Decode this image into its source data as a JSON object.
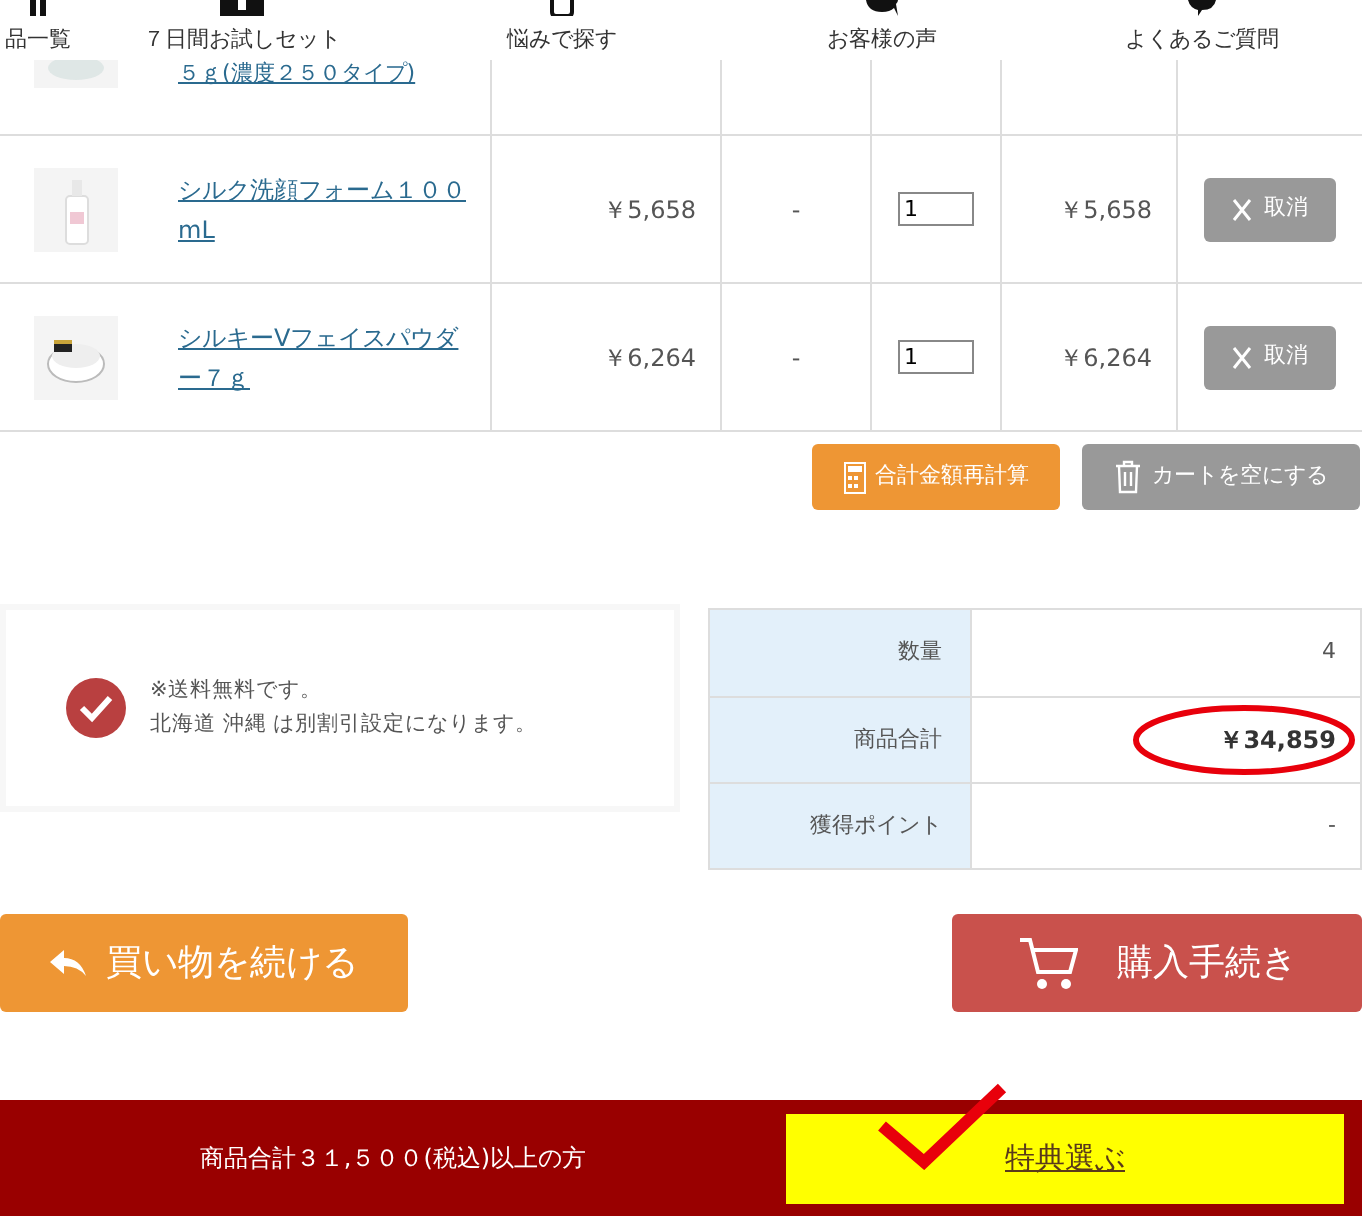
{
  "nav": [
    {
      "label": "品一覧",
      "kind": "list"
    },
    {
      "label": "７日間お試しセット",
      "kind": "box"
    },
    {
      "label": "悩みで探す",
      "kind": "phone"
    },
    {
      "label": "お客様の声",
      "kind": "chat"
    },
    {
      "label": "よくあるご質問",
      "kind": "info"
    }
  ],
  "cart": {
    "partial_row": {
      "name": "５ｇ(濃度２５０タイプ)"
    },
    "rows": [
      {
        "name": "シルク洗顔フォーム１００mL",
        "price": "￥5,658",
        "discount": "-",
        "quantity": "1",
        "subtotal": "￥5,658",
        "cancel": "取消",
        "kind": "bottle"
      },
      {
        "name": "シルキーVフェイスパウダー７ｇ",
        "price": "￥6,264",
        "discount": "-",
        "quantity": "1",
        "subtotal": "￥6,264",
        "cancel": "取消",
        "kind": "compact"
      }
    ],
    "recalc_button": "合計金額再計算",
    "empty_button": "カートを空にする"
  },
  "notice": {
    "lines": [
      "※送料無料です。",
      "北海道 沖縄 は別割引設定になります。"
    ]
  },
  "summary": [
    {
      "label": "数量",
      "value": "4",
      "circled": false
    },
    {
      "label": "商品合計",
      "value": "￥34,859",
      "circled": true
    },
    {
      "label": "獲得ポイント",
      "value": "-",
      "circled": false
    }
  ],
  "continue_button": "買い物を続ける",
  "checkout_button": "購入手続き",
  "footer": {
    "text": "商品合計３１,５００(税込)以上の方",
    "link": "特典選ぶ",
    "checked": true
  }
}
